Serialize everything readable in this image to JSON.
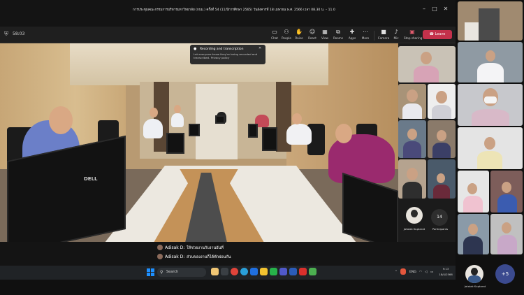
{
  "window": {
    "title": "การประชุมคณะกรรมการบริหารมหาวิทยาลัย (กบม.) ครั้งที่ 54 (11/ปีการศึกษา 2565) วันอังคารที่ 18 เมษายน พ.ศ. 2566 เวลา 08.30 น. – 11.00 น.",
    "minimize": "–",
    "maximize": "□",
    "close": "✕"
  },
  "meeting": {
    "timer": "58:03"
  },
  "toolbar": {
    "buttons": [
      {
        "label": "Chat",
        "icon": "chat-icon"
      },
      {
        "label": "People",
        "icon": "people-icon"
      },
      {
        "label": "Raise",
        "icon": "raise-hand-icon"
      },
      {
        "label": "React",
        "icon": "react-icon"
      },
      {
        "label": "View",
        "icon": "view-icon"
      },
      {
        "label": "Rooms",
        "icon": "rooms-icon"
      },
      {
        "label": "Apps",
        "icon": "apps-icon"
      },
      {
        "label": "More",
        "icon": "more-icon"
      },
      {
        "label": "Camera",
        "icon": "camera-icon"
      },
      {
        "label": "Mic",
        "icon": "mic-icon"
      },
      {
        "label": "Stop sharing",
        "icon": "share-icon"
      }
    ],
    "leave_label": "Leave",
    "leave_color": "#c4314b"
  },
  "notice": {
    "title": "Recording and transcription",
    "body": "Let everyone know they're being recorded and transcribed. Privacy policy"
  },
  "panel": {
    "presenter_name": "Jatalak Kuptarat",
    "participants_count": "14",
    "participants_label": "Participants"
  },
  "captions": [
    {
      "speaker": "Adisak D:",
      "text": "ให้ช่วยงานกับงานอันที่"
    },
    {
      "speaker": "Adisak D:",
      "text": "ส่วนของงานก็ได้พักผ่อนกัน"
    }
  ],
  "taskbar": {
    "search_label": "Search",
    "language": "ENG",
    "time": "9:13",
    "date": "18/4/2566"
  },
  "sidebar": {
    "more_label": "+5",
    "self_name": "Jatalak Kuptarat"
  }
}
